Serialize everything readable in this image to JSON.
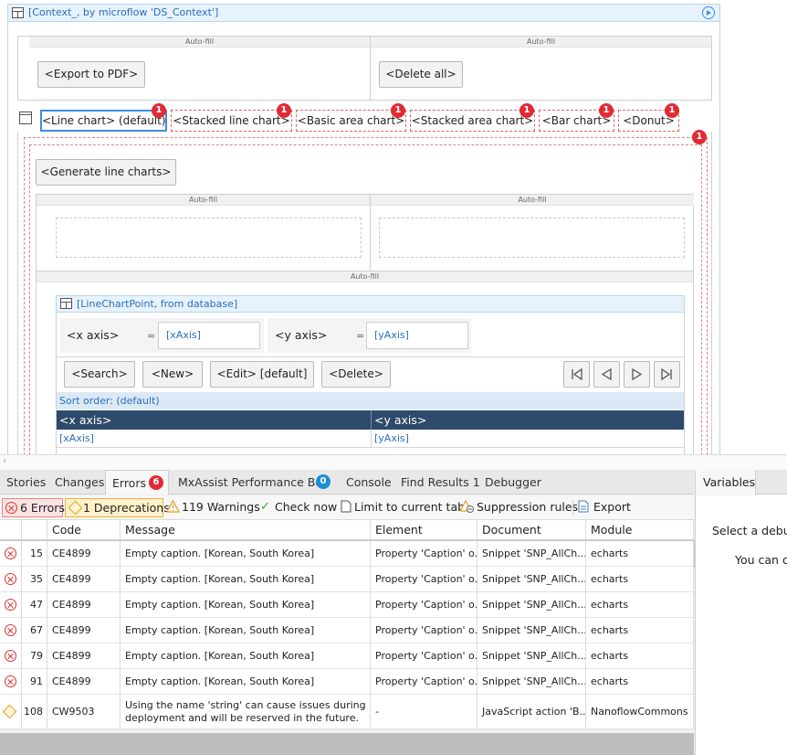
{
  "dataview": {
    "title": "[Context_, by microflow 'DS_Context']"
  },
  "top_layout": {
    "col1_label": "Auto-fill",
    "col2_label": "Auto-fill",
    "export_button": "<Export to PDF>",
    "delete_button": "<Delete all>"
  },
  "tabs": [
    {
      "label": "<Line chart> (default)",
      "badge": "1"
    },
    {
      "label": "<Stacked line chart>",
      "badge": "1"
    },
    {
      "label": "<Basic area chart>",
      "badge": "1"
    },
    {
      "label": "<Stacked area chart>",
      "badge": "1"
    },
    {
      "label": "<Bar chart>",
      "badge": "1"
    },
    {
      "label": "<Donut>",
      "badge": "1"
    }
  ],
  "tab_container_badge": "1",
  "generate_button": "<Generate line charts>",
  "inner_layout": {
    "col1_label": "Auto-fill",
    "col2_label": "Auto-fill",
    "row2_label": "Auto-fill"
  },
  "datagrid": {
    "title": "[LineChartPoint, from database]",
    "search_fields": [
      {
        "label": "<x axis>",
        "operator": "≈",
        "value": "[xAxis]"
      },
      {
        "label": "<y axis>",
        "operator": "=",
        "value": "[yAxis]"
      }
    ],
    "buttons": {
      "search": "<Search>",
      "new": "<New>",
      "edit": "<Edit> [default]",
      "delete": "<Delete>"
    },
    "sort_order": "Sort order: (default)",
    "columns": [
      "<x axis>",
      "<y axis>"
    ],
    "row": [
      "[xAxis]",
      "[yAxis]"
    ]
  },
  "bottom_tabs": {
    "stories": "Stories",
    "changes": "Changes",
    "errors": "Errors",
    "errors_count": "6",
    "mxassist": "MxAssist Performance Bot",
    "mxassist_count": "0",
    "console": "Console",
    "find_results": "Find Results 1",
    "debugger": "Debugger",
    "variables": "Variables"
  },
  "toolbar": {
    "errors": "6 Errors",
    "deprecations": "1 Deprecations",
    "warnings": "119 Warnings",
    "check_now": "Check now",
    "limit": "Limit to current tab",
    "suppression": "Suppression rules",
    "export": "Export"
  },
  "error_table": {
    "headers": [
      "Code",
      "Message",
      "Element",
      "Document",
      "Module"
    ],
    "rows": [
      {
        "type": "error",
        "line": "15",
        "code": "CE4899",
        "message": "Empty caption. [Korean, South Korea]",
        "element": "Property 'Caption' o...",
        "document": "Snippet 'SNP_AllCh...",
        "module": "echarts"
      },
      {
        "type": "error",
        "line": "35",
        "code": "CE4899",
        "message": "Empty caption. [Korean, South Korea]",
        "element": "Property 'Caption' o...",
        "document": "Snippet 'SNP_AllCh...",
        "module": "echarts"
      },
      {
        "type": "error",
        "line": "47",
        "code": "CE4899",
        "message": "Empty caption. [Korean, South Korea]",
        "element": "Property 'Caption' o...",
        "document": "Snippet 'SNP_AllCh...",
        "module": "echarts"
      },
      {
        "type": "error",
        "line": "67",
        "code": "CE4899",
        "message": "Empty caption. [Korean, South Korea]",
        "element": "Property 'Caption' o...",
        "document": "Snippet 'SNP_AllCh...",
        "module": "echarts"
      },
      {
        "type": "error",
        "line": "79",
        "code": "CE4899",
        "message": "Empty caption. [Korean, South Korea]",
        "element": "Property 'Caption' o...",
        "document": "Snippet 'SNP_AllCh...",
        "module": "echarts"
      },
      {
        "type": "error",
        "line": "91",
        "code": "CE4899",
        "message": "Empty caption. [Korean, South Korea]",
        "element": "Property 'Caption' o...",
        "document": "Snippet 'SNP_AllCh...",
        "module": "echarts"
      }
    ],
    "deprecation_row": {
      "line": "108",
      "code": "CW9503",
      "message_line1": "Using the name 'string' can cause issues during",
      "message_line2": "deployment and will be reserved in the future.",
      "element": "-",
      "document": "JavaScript action 'B...",
      "module": "NanoflowCommons"
    }
  },
  "variables_panel": {
    "line1": "Select a debug",
    "line2": "You can op"
  }
}
